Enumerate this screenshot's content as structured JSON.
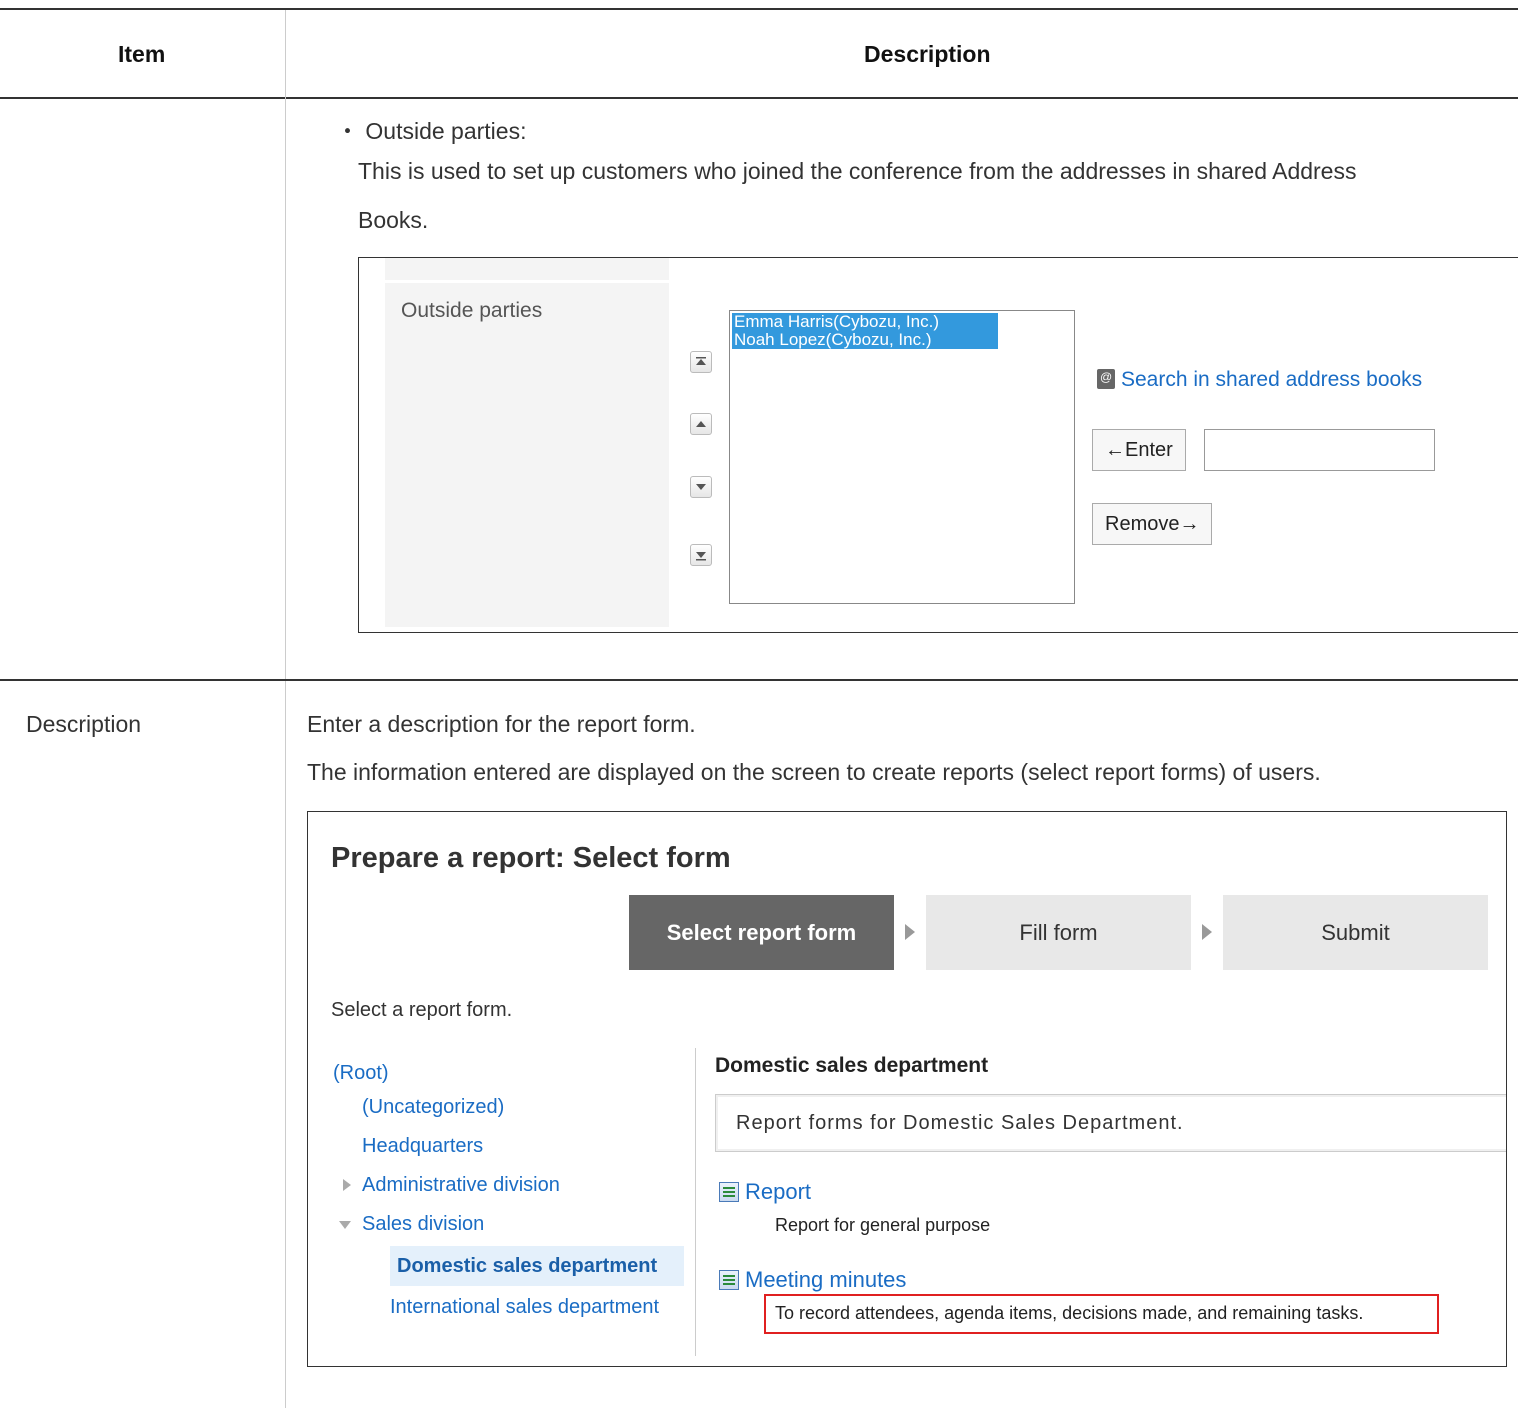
{
  "table": {
    "header_item": "Item",
    "header_description": "Description"
  },
  "row1": {
    "bullet_label": "・ Outside parties:",
    "text_line1": "This is used to set up customers who joined the conference from the addresses in shared Address",
    "text_line2": "Books."
  },
  "screenshot1": {
    "label": "Outside parties",
    "options": [
      "Emma Harris(Cybozu, Inc.)",
      "Noah Lopez(Cybozu, Inc.)"
    ],
    "search_link": "Search in shared address books",
    "enter_button": "←Enter",
    "remove_button": "Remove→",
    "enter_input_value": ""
  },
  "row2": {
    "item": "Description",
    "line1": "Enter a description for the report form.",
    "line2": "The information entered are displayed on the screen to create reports (select report forms) of users."
  },
  "screenshot2": {
    "title": "Prepare a report: Select form",
    "steps": [
      "Select report form",
      "Fill form",
      "Submit"
    ],
    "instruction": "Select a report form.",
    "tree": {
      "root": "(Root)",
      "uncategorized": "(Uncategorized)",
      "headquarters": "Headquarters",
      "administrative": "Administrative division",
      "sales": "Sales division",
      "domestic": "Domestic sales department",
      "international": "International sales department"
    },
    "category_title": "Domestic sales department",
    "category_description": "Report forms for Domestic Sales Department.",
    "forms": [
      {
        "name": "Report",
        "description": "Report for general purpose"
      },
      {
        "name": "Meeting minutes",
        "description": "To record attendees, agenda items, decisions made, and remaining tasks."
      }
    ],
    "highlight_color": "#e02020"
  }
}
